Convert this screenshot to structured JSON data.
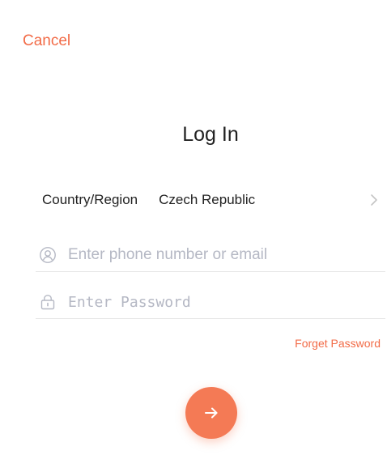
{
  "header": {
    "cancel_label": "Cancel"
  },
  "title": "Log In",
  "country": {
    "label": "Country/Region",
    "value": "Czech Republic",
    "icon": "chevron-right-icon"
  },
  "phone_field": {
    "placeholder": "Enter phone number or email",
    "value": "",
    "icon": "user-icon"
  },
  "password_field": {
    "placeholder": "Enter Password",
    "value": "",
    "icon": "lock-icon"
  },
  "forget_password_label": "Forget Password",
  "submit": {
    "icon": "arrow-right-icon"
  },
  "colors": {
    "accent": "#f26b47",
    "button": "#f47a55",
    "placeholder": "#b5b8c4",
    "divider": "#e6e6e6"
  }
}
